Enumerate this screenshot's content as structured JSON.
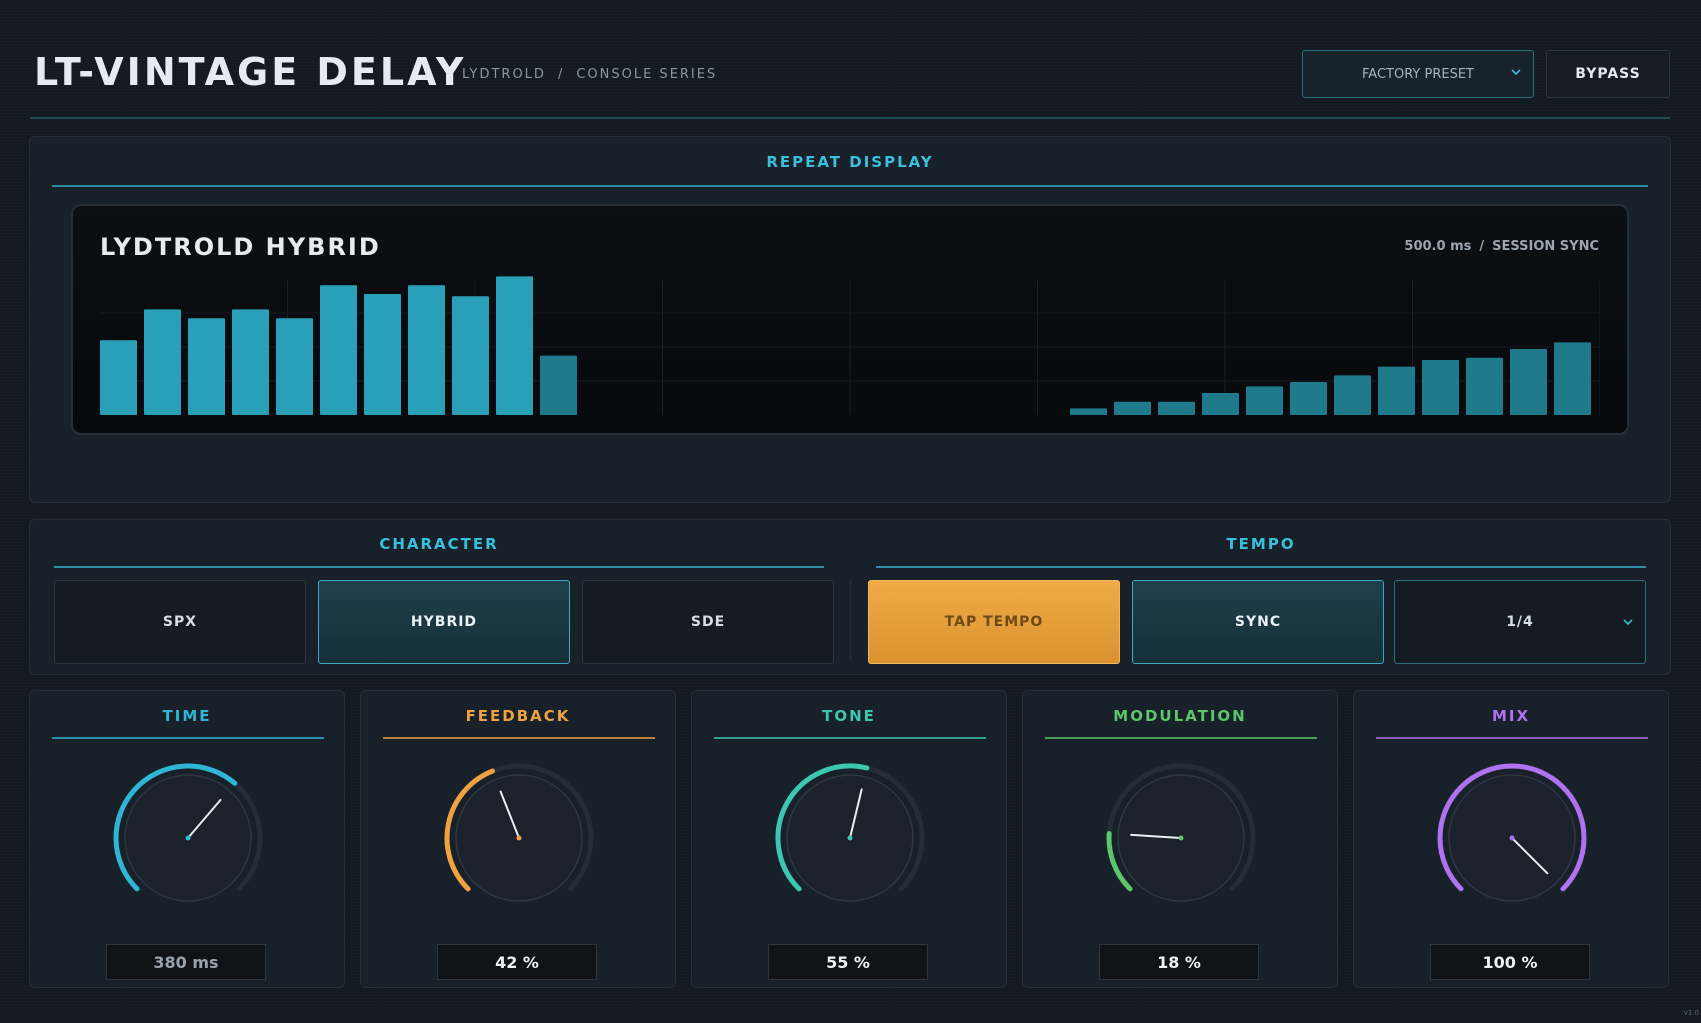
{
  "header": {
    "title": "LT-VINTAGE DELAY",
    "breadcrumb": [
      "LYDTROLD",
      "CONSOLE SERIES"
    ],
    "breadcrumb_sep": "/",
    "preset_label": "FACTORY PRESET",
    "bypass_label": "BYPASS"
  },
  "repeat_display": {
    "title": "REPEAT DISPLAY",
    "mode_name": "LYDTROLD HYBRID",
    "time_readout": "500.0 ms",
    "readout_sep": "/",
    "sync_readout": "SESSION SYNC",
    "left_bars": [
      0.34,
      0.48,
      0.44,
      0.48,
      0.44,
      0.59,
      0.55,
      0.59,
      0.54,
      0.63,
      0.27
    ],
    "right_bars": [
      0.03,
      0.06,
      0.06,
      0.1,
      0.13,
      0.15,
      0.18,
      0.22,
      0.25,
      0.26,
      0.3,
      0.33
    ],
    "bar_color": "#2aa0b8",
    "bar_color_dim": "#1f7a8c"
  },
  "character": {
    "title": "CHARACTER",
    "options": [
      "SPX",
      "HYBRID",
      "SDE"
    ],
    "selected": "HYBRID"
  },
  "tempo": {
    "title": "TEMPO",
    "tap_label": "TAP TEMPO",
    "sync_label": "SYNC",
    "division": "1/4"
  },
  "knobs": [
    {
      "label": "TIME",
      "value_text": "380 ms",
      "value": 0.65,
      "color": "#2fb6d6"
    },
    {
      "label": "FEEDBACK",
      "value_text": "42 %",
      "value": 0.42,
      "color": "#f0a240"
    },
    {
      "label": "TONE",
      "value_text": "55 %",
      "value": 0.55,
      "color": "#3cc8b0"
    },
    {
      "label": "MODULATION",
      "value_text": "18 %",
      "value": 0.18,
      "color": "#5cc66a"
    },
    {
      "label": "MIX",
      "value_text": "100 %",
      "value": 1.0,
      "color": "#b072f0"
    }
  ],
  "version": "v1.0"
}
